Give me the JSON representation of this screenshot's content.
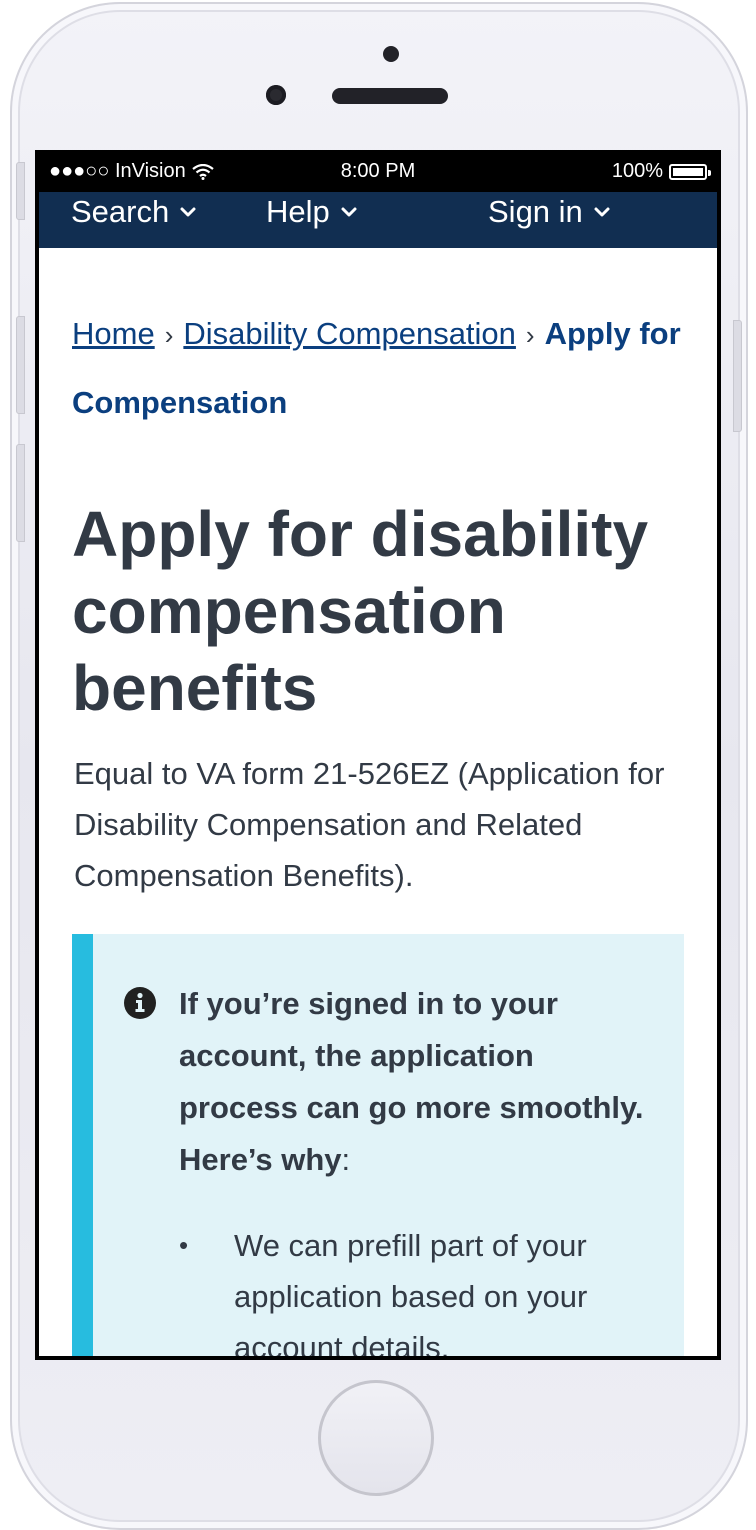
{
  "status_bar": {
    "carrier": "●●●○○ InVision",
    "time": "8:00 PM",
    "battery": "100%"
  },
  "nav": {
    "search_label": "Search",
    "help_label": "Help",
    "signin_label": "Sign in"
  },
  "breadcrumb": {
    "home": "Home",
    "separator": "›",
    "disability": "Disability Compensation",
    "current": "Apply for Compensation"
  },
  "page": {
    "title": "Apply for disability compensation benefits",
    "intro": "Equal to VA form 21-526EZ (Application for Disability Compensation and Related Compensation Benefits)."
  },
  "alert": {
    "heading": "If you’re signed in to your account, the application process can go more smoothly. Here’s why",
    "heading_suffix": ":",
    "items": [
      "We can prefill part of your application based on your account details."
    ]
  },
  "colors": {
    "nav_bg": "#112e51",
    "link": "#0b3f7f",
    "text": "#323a45",
    "alert_bg": "#e1f3f8",
    "alert_border": "#27bcdf"
  },
  "icons": [
    "wifi-icon",
    "battery-icon",
    "chevron-down-icon",
    "info-icon"
  ]
}
